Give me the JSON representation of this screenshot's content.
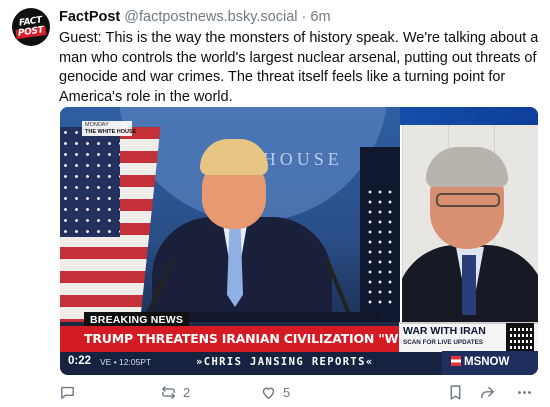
{
  "post": {
    "author_name": "FactPost",
    "handle": "@factpostnews.bsky.social",
    "separator": "·",
    "time_ago": "6m",
    "avatar_text": {
      "line1": "FACT",
      "line2": "POST"
    },
    "text": "Guest: This is the way the monsters of history speak. We're talking about a man who controls the world's largest nuclear arsenal, putting out threats of genocide and war crimes. The threat itself feels like a turning point for America's role in the world."
  },
  "video": {
    "location_bug": {
      "day": "MONDAY",
      "place": "THE WHITE HOUSE"
    },
    "backdrop_text": "THE   HOUSE",
    "breaking_label": "BREAKING NEWS",
    "headline": "TRUMP THREATENS IRANIAN CIVILIZATION \"WILL DIE TONIGHT\"",
    "timecode": "0:22",
    "clock": "VE • 12:05PT",
    "show_name": "»CHRIS JANSING REPORTS«",
    "side_box_title": "WAR WITH IRAN",
    "side_box_sub": "SCAN FOR LIVE UPDATES",
    "network": "MSNOW",
    "colors": {
      "red_bar": "#d41b24",
      "navy": "#16223f"
    }
  },
  "actions": {
    "reply": {
      "icon": "reply-icon",
      "count": ""
    },
    "repost": {
      "icon": "repost-icon",
      "count": "2"
    },
    "like": {
      "icon": "heart-icon",
      "count": "5"
    },
    "bookmark": {
      "icon": "bookmark-icon"
    },
    "share": {
      "icon": "share-icon"
    },
    "more": {
      "icon": "more-icon"
    }
  }
}
